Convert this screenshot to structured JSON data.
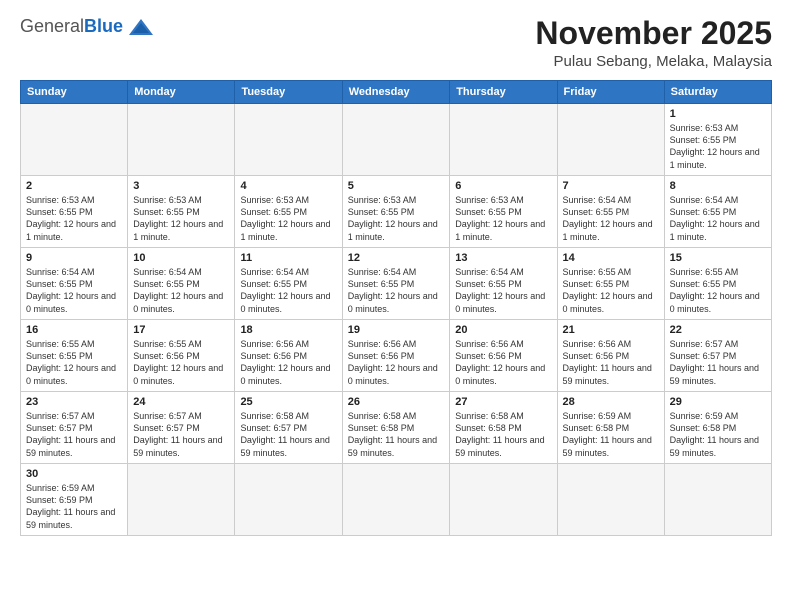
{
  "logo": {
    "general": "General",
    "blue": "Blue"
  },
  "title": {
    "month": "November 2025",
    "location": "Pulau Sebang, Melaka, Malaysia"
  },
  "weekdays": [
    "Sunday",
    "Monday",
    "Tuesday",
    "Wednesday",
    "Thursday",
    "Friday",
    "Saturday"
  ],
  "weeks": [
    [
      {
        "day": "",
        "info": ""
      },
      {
        "day": "",
        "info": ""
      },
      {
        "day": "",
        "info": ""
      },
      {
        "day": "",
        "info": ""
      },
      {
        "day": "",
        "info": ""
      },
      {
        "day": "",
        "info": ""
      },
      {
        "day": "1",
        "info": "Sunrise: 6:53 AM\nSunset: 6:55 PM\nDaylight: 12 hours and 1 minute."
      }
    ],
    [
      {
        "day": "2",
        "info": "Sunrise: 6:53 AM\nSunset: 6:55 PM\nDaylight: 12 hours and 1 minute."
      },
      {
        "day": "3",
        "info": "Sunrise: 6:53 AM\nSunset: 6:55 PM\nDaylight: 12 hours and 1 minute."
      },
      {
        "day": "4",
        "info": "Sunrise: 6:53 AM\nSunset: 6:55 PM\nDaylight: 12 hours and 1 minute."
      },
      {
        "day": "5",
        "info": "Sunrise: 6:53 AM\nSunset: 6:55 PM\nDaylight: 12 hours and 1 minute."
      },
      {
        "day": "6",
        "info": "Sunrise: 6:53 AM\nSunset: 6:55 PM\nDaylight: 12 hours and 1 minute."
      },
      {
        "day": "7",
        "info": "Sunrise: 6:54 AM\nSunset: 6:55 PM\nDaylight: 12 hours and 1 minute."
      },
      {
        "day": "8",
        "info": "Sunrise: 6:54 AM\nSunset: 6:55 PM\nDaylight: 12 hours and 1 minute."
      }
    ],
    [
      {
        "day": "9",
        "info": "Sunrise: 6:54 AM\nSunset: 6:55 PM\nDaylight: 12 hours and 0 minutes."
      },
      {
        "day": "10",
        "info": "Sunrise: 6:54 AM\nSunset: 6:55 PM\nDaylight: 12 hours and 0 minutes."
      },
      {
        "day": "11",
        "info": "Sunrise: 6:54 AM\nSunset: 6:55 PM\nDaylight: 12 hours and 0 minutes."
      },
      {
        "day": "12",
        "info": "Sunrise: 6:54 AM\nSunset: 6:55 PM\nDaylight: 12 hours and 0 minutes."
      },
      {
        "day": "13",
        "info": "Sunrise: 6:54 AM\nSunset: 6:55 PM\nDaylight: 12 hours and 0 minutes."
      },
      {
        "day": "14",
        "info": "Sunrise: 6:55 AM\nSunset: 6:55 PM\nDaylight: 12 hours and 0 minutes."
      },
      {
        "day": "15",
        "info": "Sunrise: 6:55 AM\nSunset: 6:55 PM\nDaylight: 12 hours and 0 minutes."
      }
    ],
    [
      {
        "day": "16",
        "info": "Sunrise: 6:55 AM\nSunset: 6:55 PM\nDaylight: 12 hours and 0 minutes."
      },
      {
        "day": "17",
        "info": "Sunrise: 6:55 AM\nSunset: 6:56 PM\nDaylight: 12 hours and 0 minutes."
      },
      {
        "day": "18",
        "info": "Sunrise: 6:56 AM\nSunset: 6:56 PM\nDaylight: 12 hours and 0 minutes."
      },
      {
        "day": "19",
        "info": "Sunrise: 6:56 AM\nSunset: 6:56 PM\nDaylight: 12 hours and 0 minutes."
      },
      {
        "day": "20",
        "info": "Sunrise: 6:56 AM\nSunset: 6:56 PM\nDaylight: 12 hours and 0 minutes."
      },
      {
        "day": "21",
        "info": "Sunrise: 6:56 AM\nSunset: 6:56 PM\nDaylight: 11 hours and 59 minutes."
      },
      {
        "day": "22",
        "info": "Sunrise: 6:57 AM\nSunset: 6:57 PM\nDaylight: 11 hours and 59 minutes."
      }
    ],
    [
      {
        "day": "23",
        "info": "Sunrise: 6:57 AM\nSunset: 6:57 PM\nDaylight: 11 hours and 59 minutes."
      },
      {
        "day": "24",
        "info": "Sunrise: 6:57 AM\nSunset: 6:57 PM\nDaylight: 11 hours and 59 minutes."
      },
      {
        "day": "25",
        "info": "Sunrise: 6:58 AM\nSunset: 6:57 PM\nDaylight: 11 hours and 59 minutes."
      },
      {
        "day": "26",
        "info": "Sunrise: 6:58 AM\nSunset: 6:58 PM\nDaylight: 11 hours and 59 minutes."
      },
      {
        "day": "27",
        "info": "Sunrise: 6:58 AM\nSunset: 6:58 PM\nDaylight: 11 hours and 59 minutes."
      },
      {
        "day": "28",
        "info": "Sunrise: 6:59 AM\nSunset: 6:58 PM\nDaylight: 11 hours and 59 minutes."
      },
      {
        "day": "29",
        "info": "Sunrise: 6:59 AM\nSunset: 6:58 PM\nDaylight: 11 hours and 59 minutes."
      }
    ],
    [
      {
        "day": "30",
        "info": "Sunrise: 6:59 AM\nSunset: 6:59 PM\nDaylight: 11 hours and 59 minutes."
      },
      {
        "day": "",
        "info": ""
      },
      {
        "day": "",
        "info": ""
      },
      {
        "day": "",
        "info": ""
      },
      {
        "day": "",
        "info": ""
      },
      {
        "day": "",
        "info": ""
      },
      {
        "day": "",
        "info": ""
      }
    ]
  ]
}
